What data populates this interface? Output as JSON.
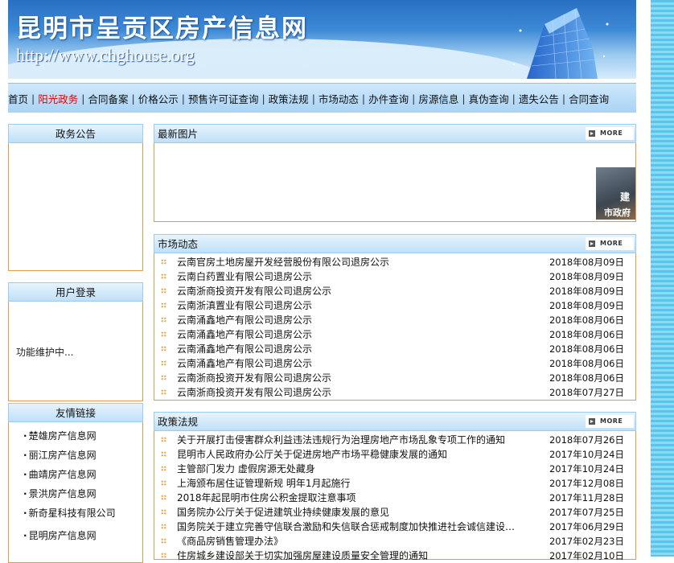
{
  "site": {
    "title": "昆明市呈贡区房产信息网",
    "url": "http://www.chghouse.org"
  },
  "nav": {
    "separator": "|",
    "items": [
      {
        "label": "首页"
      },
      {
        "label": "阳光政务",
        "active": true
      },
      {
        "label": "合同备案"
      },
      {
        "label": "价格公示"
      },
      {
        "label": "预售许可证查询"
      },
      {
        "label": "政策法规"
      },
      {
        "label": "市场动态"
      },
      {
        "label": "办件查询"
      },
      {
        "label": "房源信息"
      },
      {
        "label": "真伪查询"
      },
      {
        "label": "遗失公告"
      },
      {
        "label": "合同查询"
      }
    ]
  },
  "sidebar": {
    "announcements": {
      "title": "政务公告"
    },
    "login": {
      "title": "用户登录",
      "message": "功能维护中..."
    },
    "friend_links": {
      "title": "友情链接",
      "bullet": "·",
      "items": [
        "楚雄房产信息网",
        "丽江房产信息网",
        "曲靖房产信息网",
        "景洪房产信息网",
        "新奇星科技有限公司",
        "昆明房产信息网"
      ]
    }
  },
  "main": {
    "more_label": "MORE",
    "latest_images": {
      "title": "最新图片",
      "thumb_caption_1": "建",
      "thumb_caption_2": "市政府"
    },
    "market": {
      "title": "市场动态",
      "items": [
        {
          "title": "云南官房土地房屋开发经营股份有限公司退房公示",
          "date": "2018年08月09日"
        },
        {
          "title": "云南白药置业有限公司退房公示",
          "date": "2018年08月09日"
        },
        {
          "title": "云南浙商投资开发有限公司退房公示",
          "date": "2018年08月09日"
        },
        {
          "title": "云南浙滇置业有限公司退房公示",
          "date": "2018年08月09日"
        },
        {
          "title": "云南涌鑫地产有限公司退房公示",
          "date": "2018年08月06日"
        },
        {
          "title": "云南涌鑫地产有限公司退房公示",
          "date": "2018年08月06日"
        },
        {
          "title": "云南涌鑫地产有限公司退房公示",
          "date": "2018年08月06日"
        },
        {
          "title": "云南涌鑫地产有限公司退房公示",
          "date": "2018年08月06日"
        },
        {
          "title": "云南浙商投资开发有限公司退房公示",
          "date": "2018年08月06日"
        },
        {
          "title": "云南浙商投资开发有限公司退房公示",
          "date": "2018年07月27日"
        }
      ]
    },
    "policy": {
      "title": "政策法规",
      "items": [
        {
          "title": "关于开展打击侵害群众利益违法违规行为治理房地产市场乱象专项工作的通知",
          "date": "2018年07月26日"
        },
        {
          "title": "昆明市人民政府办公厅关于促进房地产市场平稳健康发展的通知",
          "date": "2017年10月24日"
        },
        {
          "title": "主管部门发力 虚假房源无处藏身",
          "date": "2017年10月24日"
        },
        {
          "title": "上海颁布居住证管理新规 明年1月起施行",
          "date": "2017年12月08日"
        },
        {
          "title": "2018年起昆明市住房公积金提取注意事项",
          "date": "2017年11月28日"
        },
        {
          "title": "国务院办公厅关于促进建筑业持续健康发展的意见",
          "date": "2017年07月25日"
        },
        {
          "title": "国务院关于建立完善守信联合激励和失信联合惩戒制度加快推进社会诚信建设…",
          "date": "2017年06月29日"
        },
        {
          "title": "《商品房销售管理办法》",
          "date": "2017年02月23日"
        },
        {
          "title": "住房城乡建设部关于切实加强房屋建设质量安全管理的通知",
          "date": "2017年02月10日"
        }
      ]
    }
  }
}
